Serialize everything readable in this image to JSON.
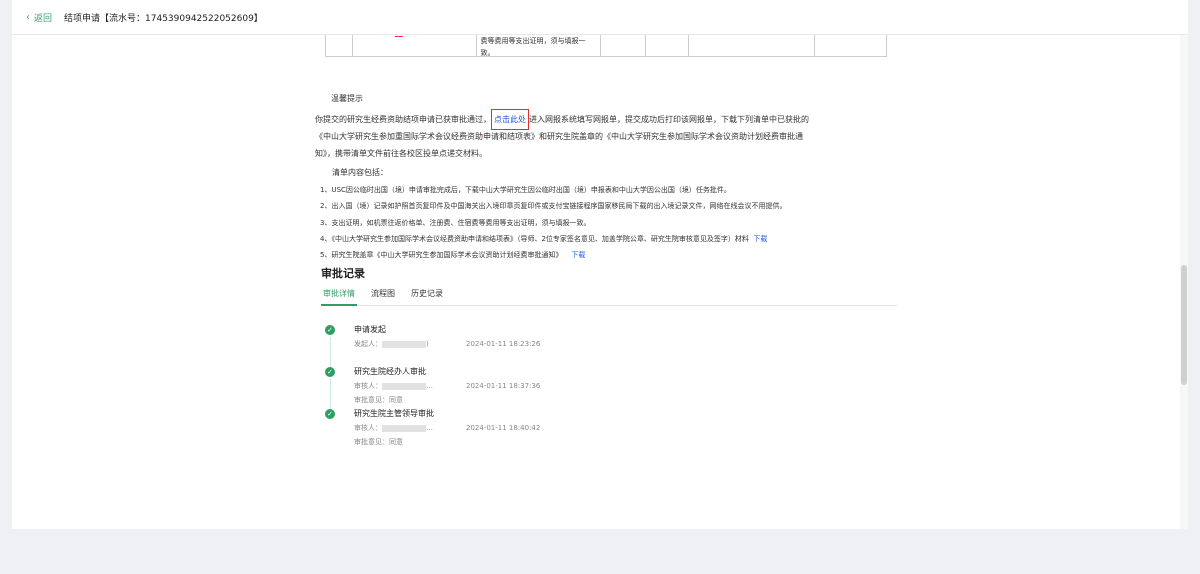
{
  "header": {
    "back_label": "返回",
    "title": "结项申请【流水号：1745390942522052609】"
  },
  "table_fragment": {
    "text_lines": [
      "费等费用等支出证明，须与填报一",
      "致。"
    ]
  },
  "tips": {
    "heading": "温馨提示",
    "p1_before": "你提交的研究生经费资助结项申请已获审批通过，",
    "p1_link": "点击此处",
    "p1_after": "进入网报系统填写网报单，提交成功后打印该网报单，下载下列清单中已获批的",
    "p2": "《中山大学研究生参加重国际学术会议经费资助申请和结项表》和研究生院盖章的《中山大学研究生参加国际学术会议资助计划经费审批通",
    "p3": "知》，携带清单文件前往各校区投单点递交材料。"
  },
  "checklist": {
    "heading": "清单内容包括：",
    "items": [
      {
        "text": "1、USC因公临时出国（境）申请审批完成后，下载中山大学研究生因公临时出国（境）申报表和中山大学因公出国（境）任务批件。",
        "link": ""
      },
      {
        "text": "2、出入国（境）记录如护照首页复印件及中国海关出入境印章页复印件或支付宝链接程序国家移民局下载的出入境记录文件，网络在线会议不用提供。",
        "link": ""
      },
      {
        "text": "3、支出证明，如机票往返价格单、注册费、住宿费等费用等支出证明，须与填报一致。",
        "link": ""
      },
      {
        "text": "4、《中山大学研究生参加国际学术会议经费资助申请和结项表》（导师、2位专家签名意见、加盖学院公章、研究生院审核意见及签字）材料",
        "link": "下载"
      },
      {
        "text": "5、研究生院盖章《中山大学研究生参加国际学术会议资助计划经费审批通知》",
        "link": "下载"
      }
    ]
  },
  "approval": {
    "title": "审批记录",
    "tabs": [
      "审批详情",
      "流程图",
      "历史记录"
    ],
    "steps": [
      {
        "title": "申请发起",
        "person_label": "发起人：",
        "person_tail": ")",
        "time": "2024-01-11 18:23:26",
        "opinion": ""
      },
      {
        "title": "研究生院经办人审批",
        "person_label": "审核人：",
        "person_tail": "…",
        "time": "2024-01-11 18:37:36",
        "opinion": "审批意见：同意"
      },
      {
        "title": "研究生院主管领导审批",
        "person_label": "审核人：",
        "person_tail": "…",
        "time": "2024-01-11 18:40:42",
        "opinion": "审批意见：同意"
      }
    ]
  },
  "colors": {
    "accent": "#2e9e63",
    "link": "#1f5bd8",
    "highlight": "#e0302a"
  }
}
